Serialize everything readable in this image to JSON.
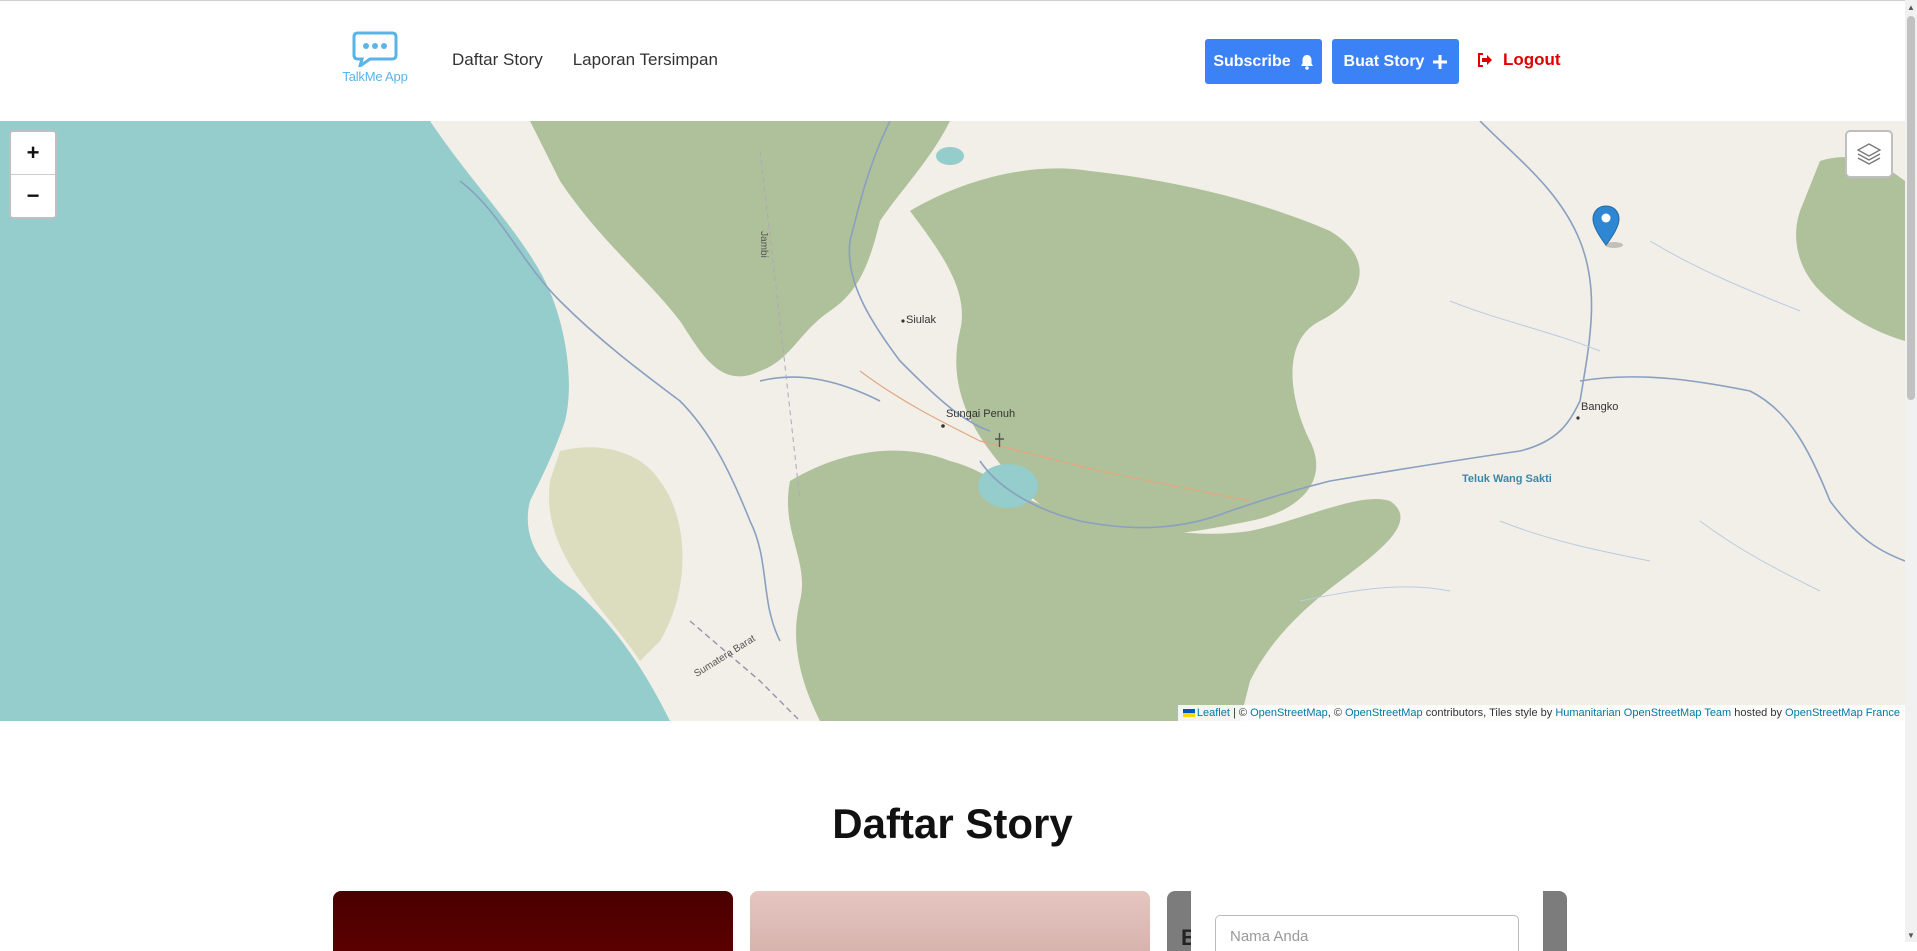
{
  "app": {
    "logo_text": "TalkMe App"
  },
  "nav": {
    "items": [
      {
        "label": "Daftar Story"
      },
      {
        "label": "Laporan Tersimpan"
      }
    ]
  },
  "actions": {
    "subscribe_label": "Subscribe",
    "create_story_label": "Buat Story",
    "logout_label": "Logout"
  },
  "map": {
    "zoom_in": "+",
    "zoom_out": "−",
    "places": {
      "siulak": "Siulak",
      "sungai_penuh": "Sungai Penuh",
      "bangko": "Bangko",
      "teluk": "Teluk Wang Sakti",
      "jambi": "Jambi",
      "sumbar": "Sumatera Barat"
    },
    "attribution": {
      "leaflet": "Leaflet",
      "sep1": " | © ",
      "osm1": "OpenStreetMap",
      "sep2": ", © ",
      "osm2": "OpenStreetMap",
      "text1": " contributors, Tiles style by ",
      "hot": "Humanitarian OpenStreetMap Team",
      "text2": " hosted by ",
      "osmfr": "OpenStreetMap France"
    }
  },
  "stories": {
    "title": "Daftar Story",
    "form_placeholder": "Nama Anda",
    "card3_letter": "B"
  },
  "colors": {
    "primary": "#3b82f6",
    "logout": "#e00000",
    "logo": "#5ab4e8"
  },
  "icons": {
    "subscribe": "bell-icon",
    "create": "plus-icon",
    "logout": "sign-out-icon",
    "layers": "layers-icon",
    "marker": "map-marker-icon"
  }
}
